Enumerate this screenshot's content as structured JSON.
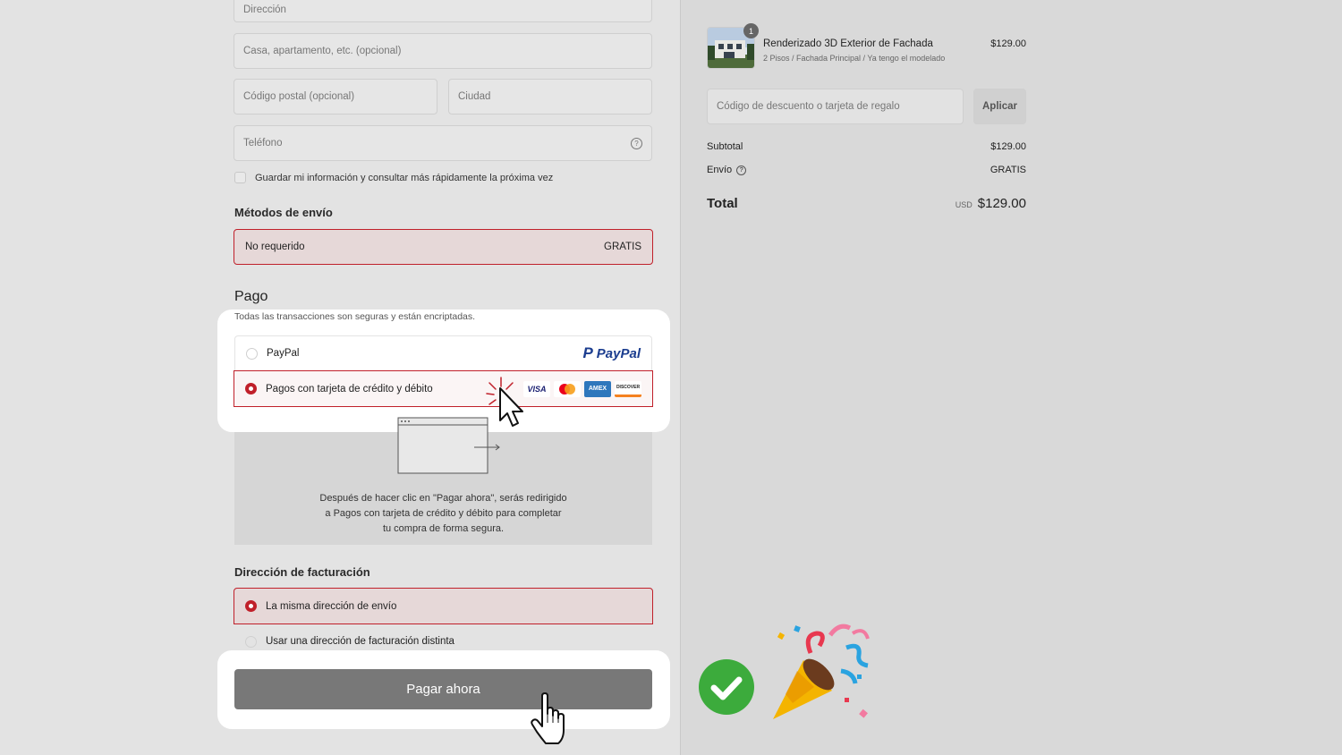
{
  "form": {
    "address_placeholder": "Dirección",
    "apartment_placeholder": "Casa, apartamento, etc. (opcional)",
    "postal_placeholder": "Código postal (opcional)",
    "city_placeholder": "Ciudad",
    "phone_placeholder": "Teléfono",
    "save_info_label": "Guardar mi información y consultar más rápidamente la próxima vez"
  },
  "shipping": {
    "title": "Métodos de envío",
    "option_label": "No requerido",
    "option_price": "GRATIS"
  },
  "payment": {
    "title": "Pago",
    "subtitle": "Todas las transacciones son seguras y están encriptadas.",
    "paypal_label": "PayPal",
    "paypal_logo_text": "PayPal",
    "card_label": "Pagos con tarjeta de crédito y débito",
    "card_brands": [
      "VISA",
      "mastercard",
      "AMEX",
      "DISCOVER"
    ],
    "redirect_text_1": "Después de hacer clic en \"Pagar ahora\", serás redirigido",
    "redirect_text_2": "a Pagos con tarjeta de crédito y débito para completar",
    "redirect_text_3": "tu compra de forma segura."
  },
  "billing": {
    "title": "Dirección de facturación",
    "same_label": "La misma dirección de envío",
    "different_label": "Usar una dirección de facturación distinta"
  },
  "pay_button_label": "Pagar ahora",
  "summary": {
    "item_qty": "1",
    "item_name": "Renderizado 3D Exterior de Fachada",
    "item_variant": "2 Pisos / Fachada Principal / Ya tengo el modelado",
    "item_price": "$129.00",
    "discount_placeholder": "Código de descuento o tarjeta de regalo",
    "apply_label": "Aplicar",
    "subtotal_label": "Subtotal",
    "subtotal_value": "$129.00",
    "shipping_label": "Envío",
    "shipping_value": "GRATIS",
    "total_label": "Total",
    "currency": "USD",
    "total_value": "$129.00"
  },
  "colors": {
    "accent_red": "#c0202a",
    "selected_bg": "#ecdada",
    "button_gray": "#787878",
    "check_green": "#3cab3c"
  }
}
